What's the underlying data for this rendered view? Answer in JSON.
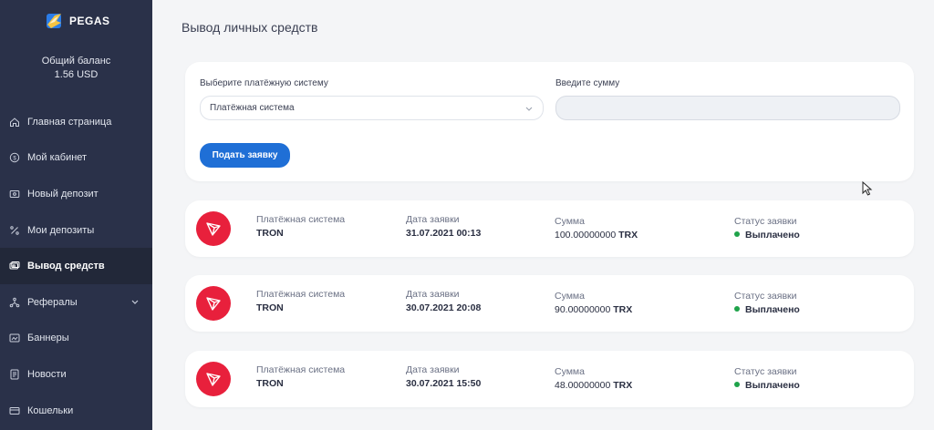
{
  "sidebar": {
    "logo_text": "PEGAS",
    "balance_label": "Общий баланс",
    "balance_value": "1.56 USD",
    "items": [
      {
        "label": "Главная страница",
        "icon": "home-icon"
      },
      {
        "label": "Мой кабинет",
        "icon": "coin-icon"
      },
      {
        "label": "Новый депозит",
        "icon": "wallet-icon"
      },
      {
        "label": "Мои депозиты",
        "icon": "percent-icon"
      },
      {
        "label": "Вывод средств",
        "icon": "cash-icon",
        "active": true
      },
      {
        "label": "Рефералы",
        "icon": "network-icon",
        "has_children": true
      },
      {
        "label": "Баннеры",
        "icon": "banner-icon"
      },
      {
        "label": "Новости",
        "icon": "news-icon"
      },
      {
        "label": "Кошельки",
        "icon": "card-icon"
      }
    ]
  },
  "page": {
    "title": "Вывод личных средств"
  },
  "form": {
    "system_label": "Выберите платёжную систему",
    "system_selected": "Платёжная система",
    "amount_label": "Введите сумму",
    "amount_value": "",
    "submit_label": "Подать заявку"
  },
  "withdrawals": {
    "system_key": "Платёжная система",
    "date_key": "Дата заявки",
    "amount_key": "Сумма",
    "status_key": "Статус заявки",
    "rows": [
      {
        "system": "TRON",
        "date": "31.07.2021 00:13",
        "amount": "100.00000000",
        "currency": "TRX",
        "status": "Выплачено"
      },
      {
        "system": "TRON",
        "date": "30.07.2021 20:08",
        "amount": "90.00000000",
        "currency": "TRX",
        "status": "Выплачено"
      },
      {
        "system": "TRON",
        "date": "30.07.2021 15:50",
        "amount": "48.00000000",
        "currency": "TRX",
        "status": "Выплачено"
      }
    ]
  },
  "colors": {
    "sidebar_bg": "#2a3149",
    "accent": "#1f6fd6",
    "tron_red": "#e8203c",
    "status_green": "#1fa34a"
  }
}
